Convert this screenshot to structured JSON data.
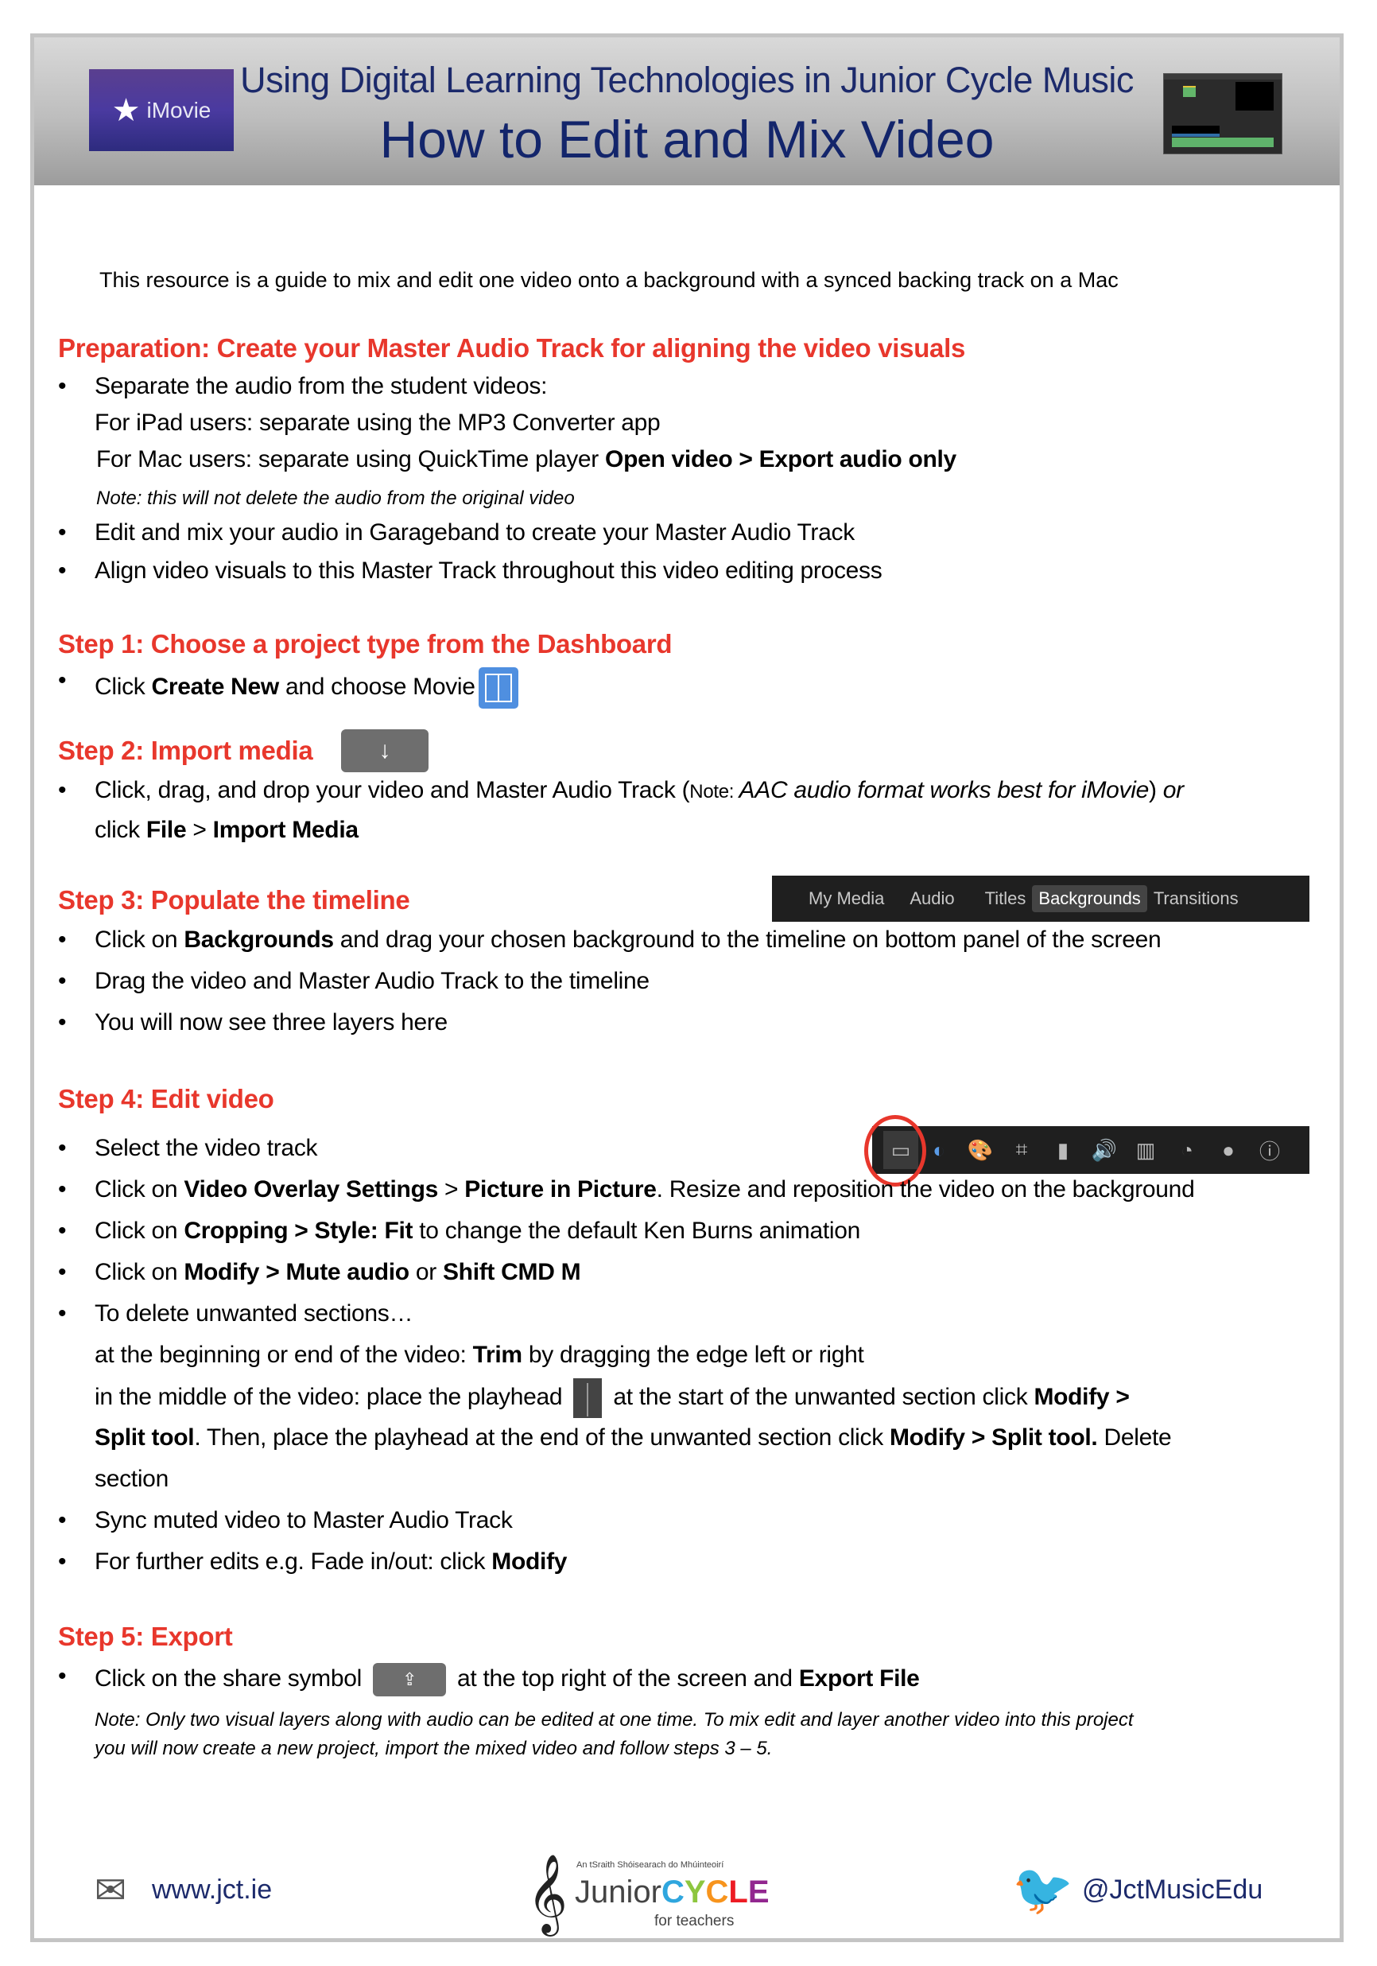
{
  "header": {
    "logo_label": "iMovie",
    "subtitle": "Using Digital Learning Technologies in Junior Cycle Music",
    "title": "How to Edit and Mix Video"
  },
  "intro": "This resource is a guide to mix and edit one video onto a background with a synced backing track on a Mac",
  "preparation": {
    "heading": "Preparation: Create your Master Audio Track for aligning the video visuals",
    "item1": "Separate the audio from the student videos:",
    "item1_ipad": "For iPad users: separate using the MP3 Converter app",
    "item1_mac_prefix": "For Mac users: separate using QuickTime player ",
    "item1_mac_bold": "Open video > Export audio only",
    "item1_note": "Note: this will not delete the audio from the original video",
    "item2": "Edit and mix your audio in Garageband to create your Master Audio Track",
    "item3": "Align video visuals to this Master Track throughout this video editing process"
  },
  "step1": {
    "heading": "Step 1: Choose a project type from the Dashboard",
    "item1_a": "Click ",
    "item1_b": "Create New",
    "item1_c": " and choose Movie"
  },
  "step2": {
    "heading": "Step 2: Import media",
    "import_icon": "↓",
    "item1_a": "Click, drag, and drop your video and Master Audio Track (",
    "item1_note": "Note: ",
    "item1_italic": "AAC audio format works best for iMovie",
    "item1_close": ") ",
    "item1_or": "or",
    "item1_line2_a": "click ",
    "item1_line2_b": "File",
    "item1_line2_c": " > ",
    "item1_line2_d": "Import Media"
  },
  "step3": {
    "heading": "Step 3: Populate the timeline",
    "tabs": [
      "My Media",
      "Audio",
      "Titles",
      "Backgrounds",
      "Transitions"
    ],
    "active_tab": "Backgrounds",
    "item1_a": "Click on ",
    "item1_b": "Backgrounds",
    "item1_c": " and drag your chosen background to the timeline on bottom panel of the screen",
    "item2": "Drag the video and Master Audio Track to the timeline",
    "item3": "You will now see three layers here"
  },
  "step4": {
    "heading": "Step 4: Edit video",
    "toolbar_icons": [
      "video-overlay-icon",
      "color-balance-icon",
      "color-correction-icon",
      "crop-icon",
      "stabilization-icon",
      "volume-icon",
      "noise-reduction-icon",
      "speed-icon",
      "clip-filter-icon",
      "info-icon"
    ],
    "item1": "Select the video track",
    "item2_a": "Click on ",
    "item2_b": "Video Overlay Settings",
    "item2_c": " > ",
    "item2_d": "Picture in Picture",
    "item2_e": ". Resize and reposition the video on the background",
    "item3_a": "Click on ",
    "item3_b": "Cropping > Style: Fit",
    "item3_c": " to change the default Ken Burns animation",
    "item4_a": "Click on ",
    "item4_b": "Modify > Mute audio",
    "item4_c": " or ",
    "item4_d": "Shift CMD M",
    "item5": "To delete unwanted sections…",
    "item5_l1_a": "at the beginning or end of the video: ",
    "item5_l1_b": "Trim",
    "item5_l1_c": " by dragging the edge left or right",
    "item5_l2_a": "in the middle of the video: place the playhead ",
    "item5_l2_b": " at the start of the unwanted section click ",
    "item5_l2_c": "Modify >",
    "item5_l3_a": "Split tool",
    "item5_l3_b": ". Then, place the playhead at the end of the unwanted section click ",
    "item5_l3_c": "Modify > Split tool.",
    "item5_l3_d": " Delete",
    "item5_l4": "section",
    "item6": "Sync muted video to Master Audio Track",
    "item7_a": "For further edits e.g. Fade in/out: click ",
    "item7_b": "Modify"
  },
  "step5": {
    "heading": "Step 5: Export",
    "item1_a": "Click on the share symbol ",
    "item1_b": " at the top right of the screen and ",
    "item1_c": "Export File",
    "share_icon": "⇪",
    "note_line1": "Note: Only two visual layers along with audio can be edited at one time. To mix edit and layer another video into this project",
    "note_line2": "you will now create a new project, import the mixed video and follow steps 3 – 5."
  },
  "footer": {
    "website": "www.jct.ie",
    "logo_irish": "An tSraith Shóisearach do Mhúinteoirí",
    "logo_junior": "Junior",
    "logo_cycle": [
      "C",
      "Y",
      "C",
      "L",
      "E"
    ],
    "logo_teachers": "for teachers",
    "twitter": "@JctMusicEdu"
  },
  "colors": {
    "heading_red": "#e8372c",
    "title_navy": "#13256b",
    "movie_icon_blue": "#4f8fe0"
  }
}
